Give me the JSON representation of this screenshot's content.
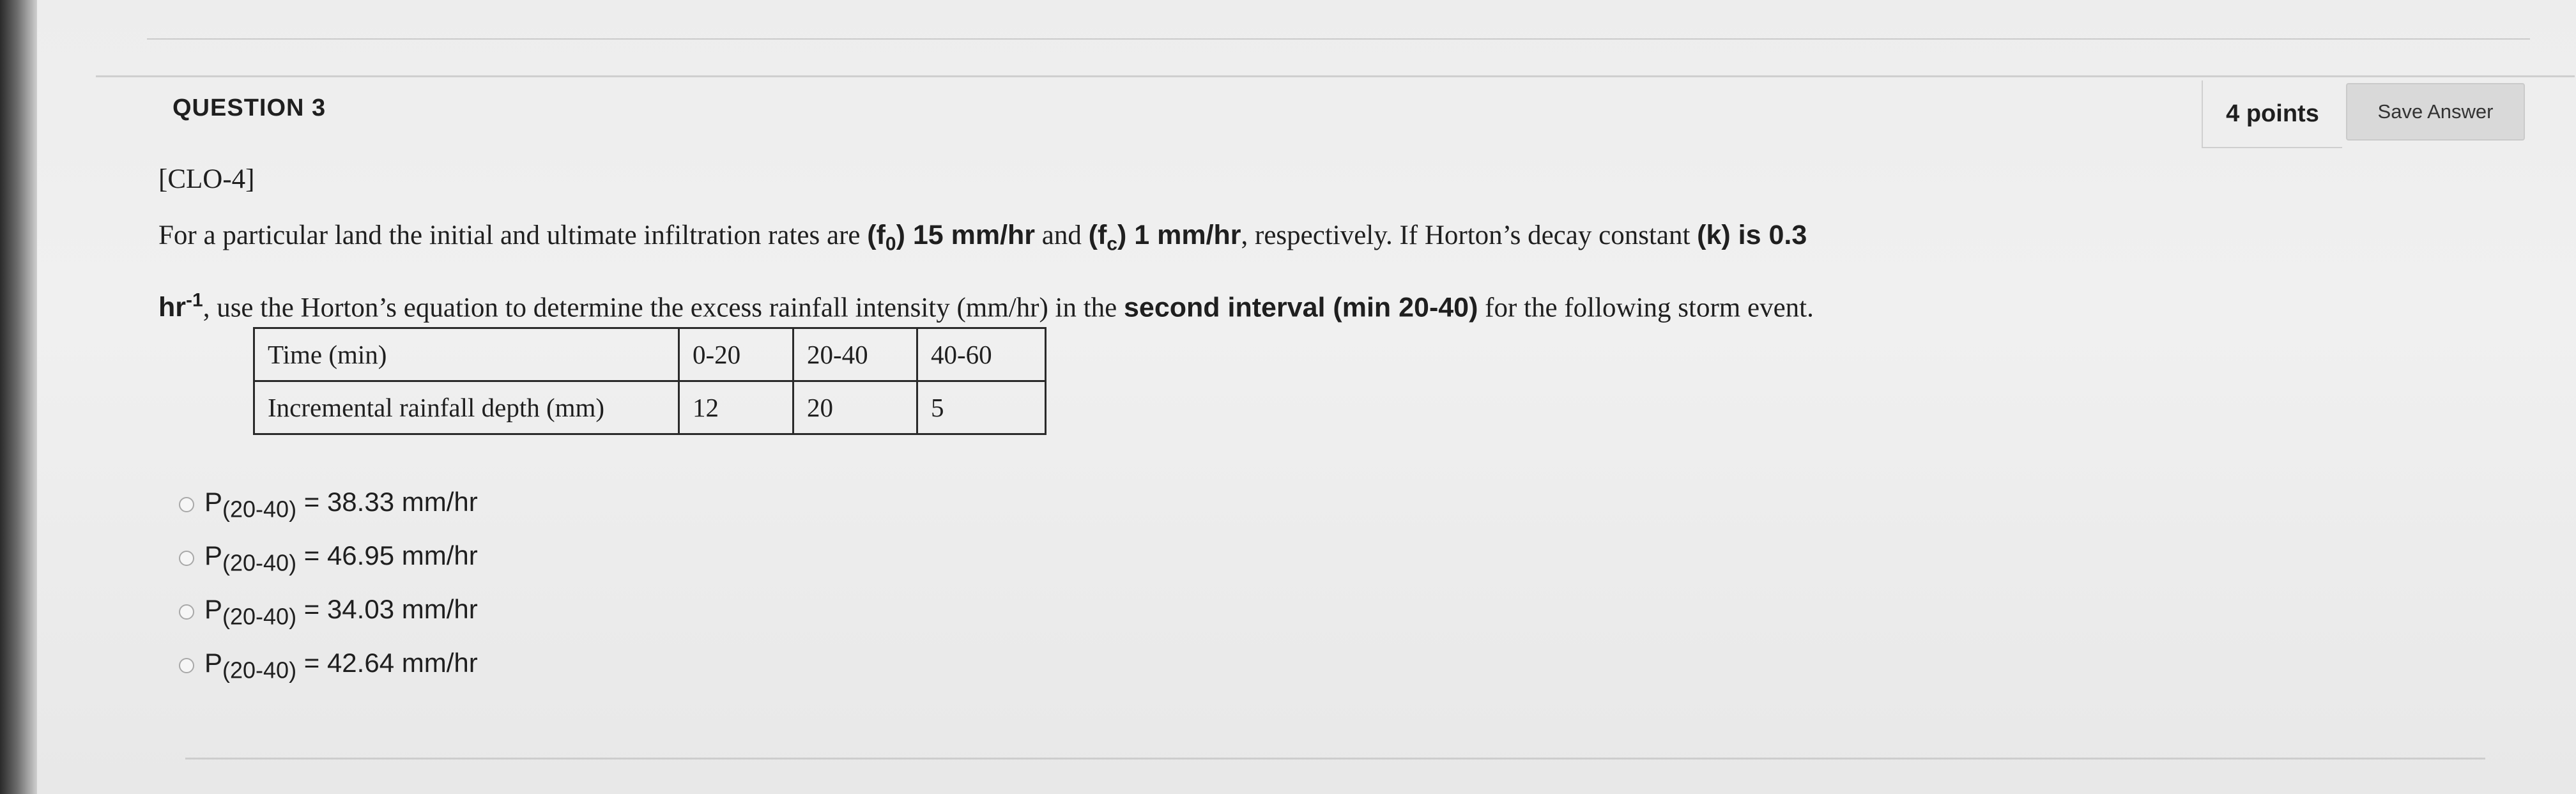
{
  "question": {
    "title": "QUESTION 3",
    "points": "4 points",
    "save_label": "Save Answer",
    "clo": "[CLO-4]",
    "text": {
      "p1": "For a particular land the initial and ultimate infiltration rates are ",
      "f0_label": "(f",
      "f0_sub": "0",
      "f0_value": ") 15 mm/hr",
      "and": " and ",
      "fc_label": "(f",
      "fc_sub": "c",
      "fc_value": ") 1 mm/hr",
      "p2": ", respectively. If Horton’s decay constant ",
      "k_bold": "(k) is 0.3",
      "hr_unit": "hr",
      "hr_exp": "-1",
      "p3": ", use the Horton’s equation to determine the excess rainfall intensity (mm/hr) in the ",
      "interval_bold": "second interval (min 20-40)",
      "p4": " for the following storm event."
    },
    "table": {
      "rows": [
        [
          "Time (min)",
          "0-20",
          "20-40",
          "40-60"
        ],
        [
          "Incremental rainfall depth (mm)",
          "12",
          "20",
          "5"
        ]
      ]
    },
    "options": [
      {
        "p": "P",
        "sub": "(20-40)",
        "value": " = 38.33 mm/hr"
      },
      {
        "p": "P",
        "sub": "(20-40)",
        "value": " = 46.95 mm/hr"
      },
      {
        "p": "P",
        "sub": "(20-40)",
        "value": " = 34.03 mm/hr"
      },
      {
        "p": "P",
        "sub": "(20-40)",
        "value": " = 42.64 mm/hr"
      }
    ]
  }
}
